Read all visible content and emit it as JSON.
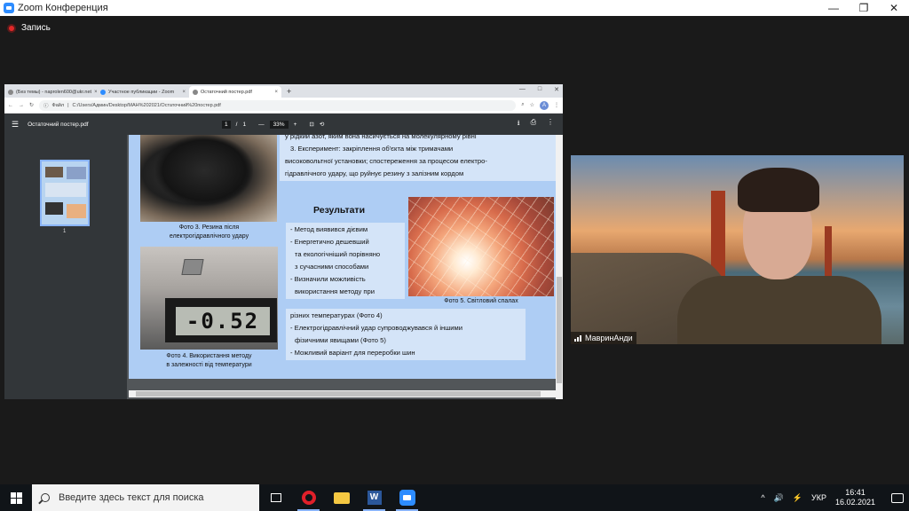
{
  "zoom": {
    "title": "Zoom Конференция",
    "controls": {
      "minimize": "—",
      "maximize": "❐",
      "close": "✕"
    },
    "recording_label": "Запись",
    "participant_name": "МавринАнди"
  },
  "chrome": {
    "tabs": [
      {
        "label": "(Без темы) - naprolen600@ukr.net",
        "close": "×"
      },
      {
        "label": "Участное публикации - Zoom",
        "close": "×"
      },
      {
        "label": "Остаточний постер.pdf",
        "close": "×"
      }
    ],
    "new_tab": "+",
    "window_controls": {
      "minimize": "—",
      "maximize": "□",
      "close": "✕"
    },
    "nav": {
      "back": "←",
      "forward": "→",
      "reload": "↻"
    },
    "url_scheme": "Файл",
    "url": "C:/Users/Админ/Desktop/МАН%202021/Остаточний%20постер.pdf",
    "avatar_letter": "А"
  },
  "pdf": {
    "file_name": "Остаточний постер.pdf",
    "page_current": "1",
    "page_sep": "/",
    "page_total": "1",
    "zoom_minus": "—",
    "zoom_value": "33%",
    "zoom_plus": "+",
    "thumb_page": "1"
  },
  "poster": {
    "text_top_line1": "у рідкий азот, яким вона насичується на молекулярному рівні",
    "text_top_line2": "3. Експеримент: закріплення об'єкта між тримачами",
    "text_top_line3": "високовольтної установки; спостереження за процесом електро-",
    "text_top_line4": "гідравлічного удару, що руйнує резину з залізним кордом",
    "caption_photo3_line1": "Фото 3. Резина після",
    "caption_photo3_line2": "електрогідравлічного удару",
    "results_heading": "Результати",
    "result_1": "- Метод виявився дієвим",
    "result_2a": "- Енергетично дешевший",
    "result_2b": "та екологічніший порівняно",
    "result_2c": "з сучасними способами",
    "result_3a": "- Визначили можливість",
    "result_3b": "використання методу при",
    "result_3c": "різних температурах (Фото 4)",
    "result_4a": "- Електрогідравлічний удар супроводжувався й іншими",
    "result_4b": "фізичними явищами (Фото 5)",
    "result_5": "- Можливий варіант для переробки шин",
    "caption_photo4_line1": "Фото 4. Використання методу",
    "caption_photo4_line2": "в залежності від температури",
    "caption_photo5": "Фото 5. Світловий спалах",
    "meter_display": "-0.52"
  },
  "taskbar": {
    "search_placeholder": "Введите здесь текст для поиска",
    "word_letter": "W",
    "tray_chevron": "^",
    "tray_volume": "🔊",
    "tray_network": "⚡",
    "language": "УКР",
    "time": "16:41",
    "date": "16.02.2021"
  },
  "colors": {
    "zoom_blue": "#2D8CFF",
    "poster_bg": "#aecdf4",
    "record_red": "#e02828"
  }
}
